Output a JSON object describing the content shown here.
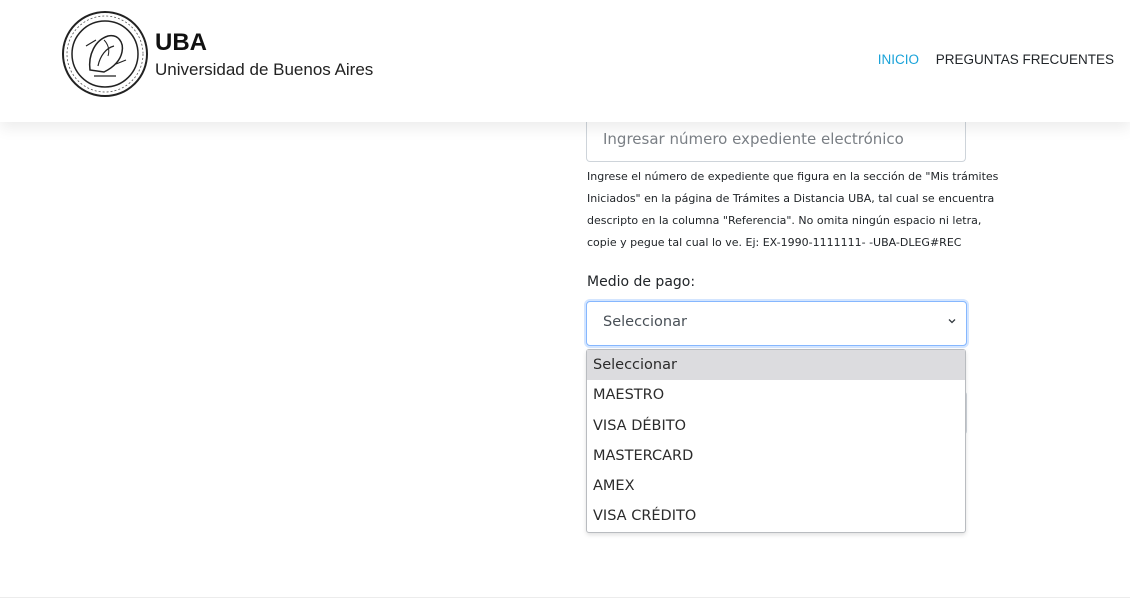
{
  "header": {
    "logo_icon": "uba-seal-icon",
    "brand_title": "UBA",
    "brand_subtitle": "Universidad de Buenos Aires",
    "nav": [
      {
        "label": "INICIO",
        "active": true
      },
      {
        "label": "PREGUNTAS FRECUENTES",
        "active": false
      }
    ],
    "accent_color": "#1aa3d9"
  },
  "form": {
    "expediente_placeholder": "Ingresar número expediente electrónico",
    "help_lines": [
      "Ingrese el número de expediente que figura en la sección de \"Mis trámites",
      "Iniciados\" en la página de Trámites a Distancia UBA, tal cual se encuentra",
      "descripto en la columna \"Referencia\". No omita ningún espacio ni letra,",
      "copie y pegue tal cual lo ve. Ej: EX-1990-1111111- -UBA-DLEG#REC"
    ],
    "medio_pago_label": "Medio de pago:",
    "medio_pago_selected": "Seleccionar",
    "medio_pago_options": [
      "Seleccionar",
      "MAESTRO",
      "VISA DÉBITO",
      "MASTERCARD",
      "AMEX",
      "VISA CRÉDITO"
    ]
  }
}
